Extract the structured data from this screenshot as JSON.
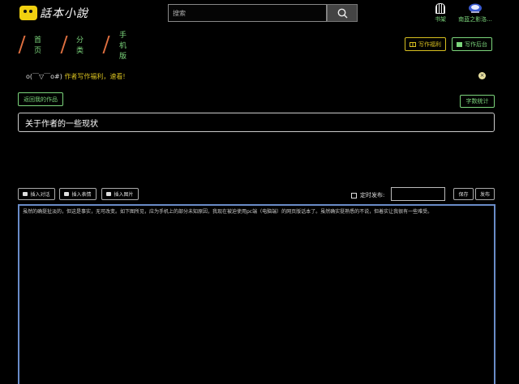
{
  "logo": {
    "text": "話本小說"
  },
  "search": {
    "placeholder": "搜索"
  },
  "header_links": {
    "bookshelf": "书架",
    "user": "南蓝之影洛..."
  },
  "nav": {
    "items": [
      "首页",
      "分类",
      "手机版"
    ]
  },
  "actions": {
    "write_benefit": "写作福利",
    "write_backend": "写作后台"
  },
  "notice": {
    "emoticon": "o(￣▽￣o#)",
    "message": "作者写作福利，速看!"
  },
  "buttons": {
    "back_to_works": "返回我的作品",
    "word_count": "字数统计"
  },
  "article": {
    "title": "关于作者的一些现状",
    "body": "虽然的确挺扯淡的，但这是事实，无可改变。如下图所见，应为手机上的部分未知原因，我现在被迫使用pc端（电脑端）的网页版话本了。虽然确实挺熟悉的不说，但着实让我很有一些难受。"
  },
  "toolbar": {
    "insert_dialogue": "插入对话",
    "insert_emoji": "插入表情",
    "insert_image": "插入图片"
  },
  "schedule": {
    "label": "定时发布:"
  },
  "publish": {
    "save": "保存",
    "publish": "发布"
  },
  "colors": {
    "accent_green": "#7cd67c",
    "accent_yellow": "#d8c020",
    "separator": "#e07040",
    "editor_border": "#6a8cc8"
  }
}
